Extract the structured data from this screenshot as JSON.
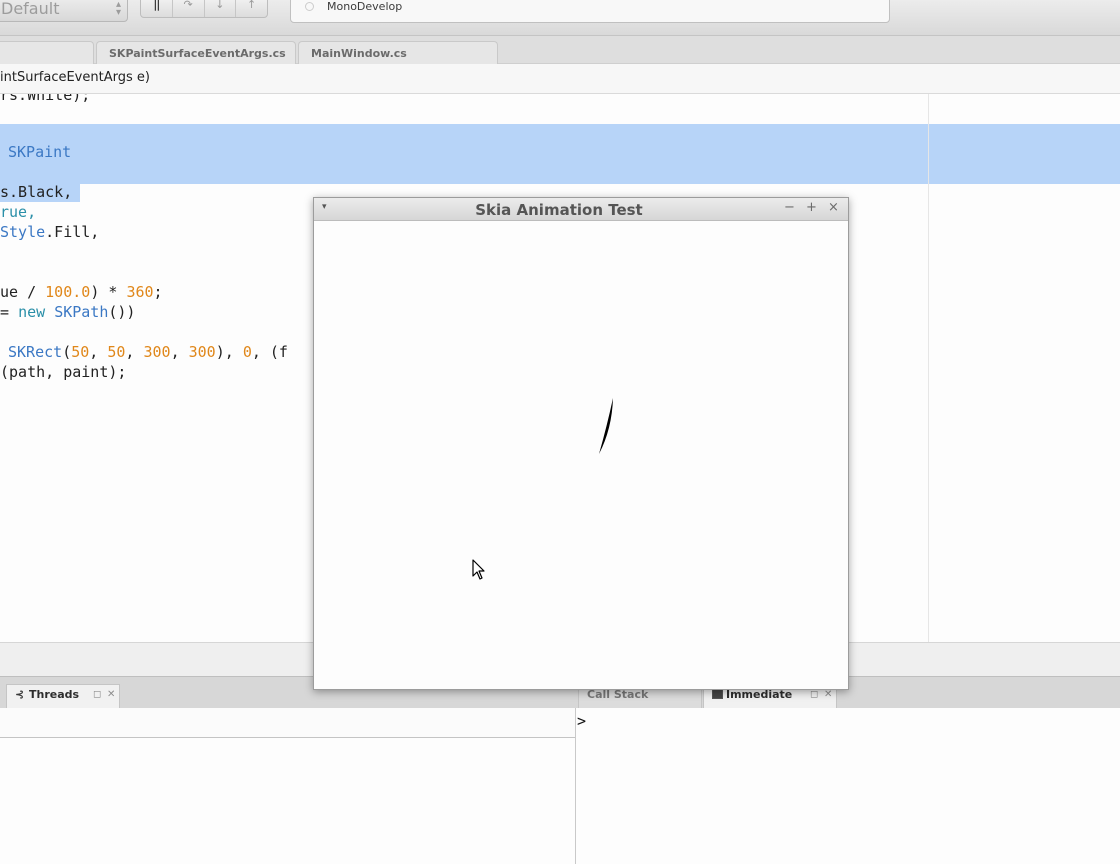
{
  "toolbar": {
    "config_value": "Default",
    "status_text": "MonoDevelop",
    "debug_buttons": [
      "pause",
      "step-over",
      "step-into",
      "step-out"
    ]
  },
  "doc_tabs": [
    {
      "label": ""
    },
    {
      "label": "SKPaintSurfaceEventArgs.cs"
    },
    {
      "label": "MainWindow.cs"
    }
  ],
  "pathbar": {
    "text": "intSurfaceEventArgs e)"
  },
  "editor": {
    "lines": [
      {
        "text": "rs.White);"
      },
      {
        "text": "SKPaint"
      },
      {
        "text": "s.Black,"
      },
      {
        "text": "rue,"
      },
      {
        "text": "Style.Fill,"
      },
      {
        "text": "ue / 100.0) * 360;"
      },
      {
        "text": "= new SKPath())"
      },
      {
        "text": "SKRect(50, 50, 300, 300), 0, (f"
      },
      {
        "text": "(path, paint);"
      }
    ]
  },
  "window": {
    "title": "Skia Animation Test",
    "buttons": {
      "minimize": "−",
      "maximize": "+",
      "close": "×"
    },
    "menu_icon": "▾"
  },
  "pads": {
    "threads_label": "Threads",
    "callstack_label": "Call Stack",
    "immediate_label": "Immediate",
    "immediate_prompt": ">"
  },
  "colors": {
    "selection": "#b7d4f8",
    "keyword": "#2a8fa8",
    "type": "#3b78c4",
    "number": "#e0871a"
  }
}
